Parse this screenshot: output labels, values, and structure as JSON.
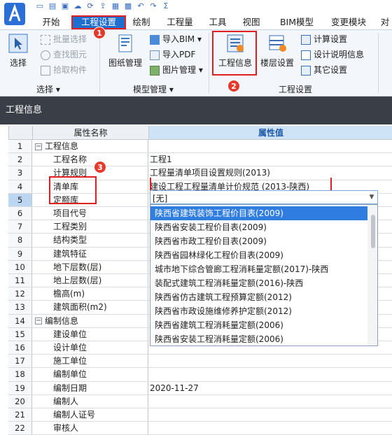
{
  "quick_access": {
    "icons": [
      "new-file-icon",
      "open-folder-icon",
      "save-icon",
      "cloud-icon",
      "sync-icon",
      "export-icon",
      "report-icon",
      "calculator-icon",
      "undo-icon",
      "redo-icon",
      "sum-icon"
    ]
  },
  "tabs": [
    "开始",
    "工程设置",
    "绘制",
    "工程量",
    "工具",
    "视图",
    "BIM模型",
    "变更模块",
    "对"
  ],
  "ribbon": {
    "select_group": {
      "big": "选择",
      "items": [
        "批量选择",
        "查找图元",
        "拾取构件"
      ],
      "label": "选择 ▾"
    },
    "model_group": {
      "big": "图纸管理",
      "items": [
        "导入BIM ▾",
        "导入PDF",
        "图片管理 ▾"
      ],
      "label": "模型管理 ▾"
    },
    "project_group": {
      "big1": "工程信息",
      "big2": "楼层设置",
      "items": [
        "计算设置",
        "设计说明信息",
        "其它设置"
      ],
      "label": "工程设置"
    }
  },
  "panel": {
    "title": "工程信息"
  },
  "grid": {
    "col_name": "属性名称",
    "col_value": "属性值",
    "rows": [
      {
        "num": "1",
        "name": "工程信息",
        "value": "",
        "group": true
      },
      {
        "num": "2",
        "name": "工程名称",
        "value": "工程1"
      },
      {
        "num": "3",
        "name": "计算规则",
        "value": "工程量清单项目设置规则(2013)"
      },
      {
        "num": "4",
        "name": "清单库",
        "value": "建设工程工程量清单计价规范 (2013-陕西)"
      },
      {
        "num": "5",
        "name": "定额库",
        "value": ""
      },
      {
        "num": "6",
        "name": "项目代号",
        "value": ""
      },
      {
        "num": "7",
        "name": "工程类别",
        "value": ""
      },
      {
        "num": "8",
        "name": "结构类型",
        "value": ""
      },
      {
        "num": "9",
        "name": "建筑特征",
        "value": ""
      },
      {
        "num": "10",
        "name": "地下层数(层)",
        "value": ""
      },
      {
        "num": "11",
        "name": "地上层数(层)",
        "value": ""
      },
      {
        "num": "12",
        "name": "檐高(m)",
        "value": ""
      },
      {
        "num": "13",
        "name": "建筑面积(m2)",
        "value": ""
      },
      {
        "num": "14",
        "name": "编制信息",
        "value": "",
        "group": true
      },
      {
        "num": "15",
        "name": "建设单位",
        "value": ""
      },
      {
        "num": "16",
        "name": "设计单位",
        "value": ""
      },
      {
        "num": "17",
        "name": "施工单位",
        "value": ""
      },
      {
        "num": "18",
        "name": "编制单位",
        "value": ""
      },
      {
        "num": "19",
        "name": "编制日期",
        "value": "2020-11-27"
      },
      {
        "num": "20",
        "name": "编制人",
        "value": ""
      },
      {
        "num": "21",
        "name": "编制人证号",
        "value": ""
      },
      {
        "num": "22",
        "name": "审核人",
        "value": ""
      }
    ]
  },
  "combo": {
    "value": "[无]"
  },
  "dropdown": {
    "items": [
      "陕西省建筑装饰工程价目表(2009)",
      "陕西省安装工程价目表(2009)",
      "陕西省市政工程价目表(2009)",
      "陕西省园林绿化工程价目表(2009)",
      "城市地下综合管廊工程消耗量定额(2017)-陕西",
      "装配式建筑工程消耗量定额(2016)-陕西",
      "陕西省仿古建筑工程预算定额(2012)",
      "陕西省市政设施维修养护定额(2012)",
      "陕西省建筑工程消耗量定额(2006)",
      "陕西省安装工程消耗量定额(2006)"
    ],
    "highlighted_index": 0
  },
  "annotations": [
    "1",
    "2",
    "3"
  ],
  "colors": {
    "accent": "#1f6fd1",
    "annotation": "#e53a2b",
    "highlight": "#2f7de0",
    "panel_bar": "#3a3f47"
  }
}
